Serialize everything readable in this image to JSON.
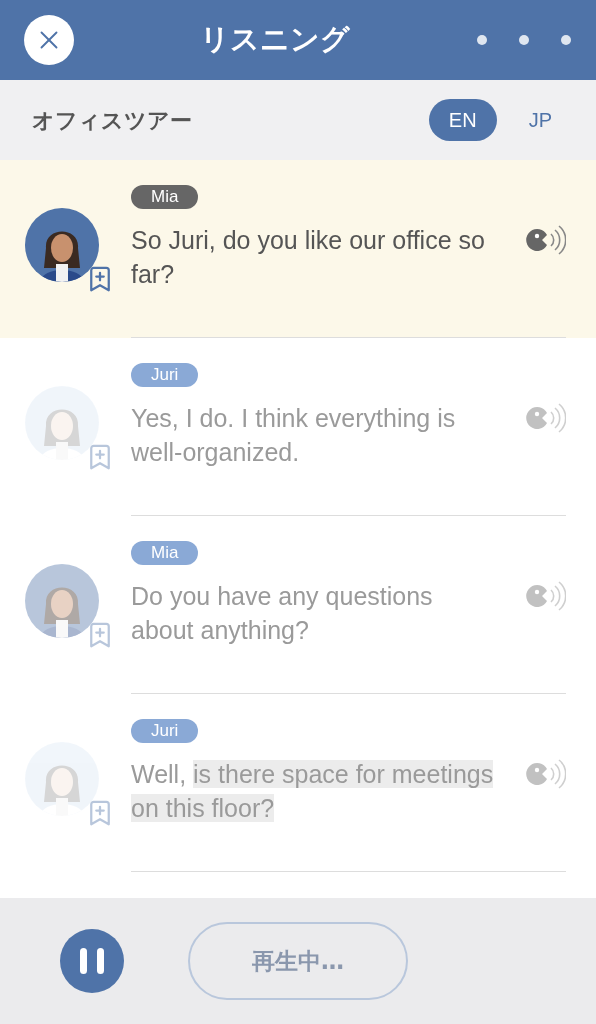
{
  "header": {
    "title": "リスニング"
  },
  "subheader": {
    "title": "オフィスツアー",
    "languages": [
      {
        "label": "EN",
        "selected": true
      },
      {
        "label": "JP",
        "selected": false
      }
    ]
  },
  "lines": [
    {
      "speaker": "Mia",
      "selected": true,
      "segments": [
        {
          "text": "So Juri, do you like our office so far?",
          "highlighted": false
        }
      ]
    },
    {
      "speaker": "Juri",
      "selected": false,
      "segments": [
        {
          "text": "Yes, I do. I think everything is well-organized.",
          "highlighted": false
        }
      ]
    },
    {
      "speaker": "Mia",
      "selected": false,
      "segments": [
        {
          "text": "Do you have any questions about anything?",
          "highlighted": false
        }
      ]
    },
    {
      "speaker": "Juri",
      "selected": false,
      "segments": [
        {
          "text": "Well, ",
          "highlighted": false
        },
        {
          "text": "is there space for meetings on this floor?",
          "highlighted": true
        }
      ]
    }
  ],
  "player": {
    "status": "再生中…",
    "playing": true
  }
}
